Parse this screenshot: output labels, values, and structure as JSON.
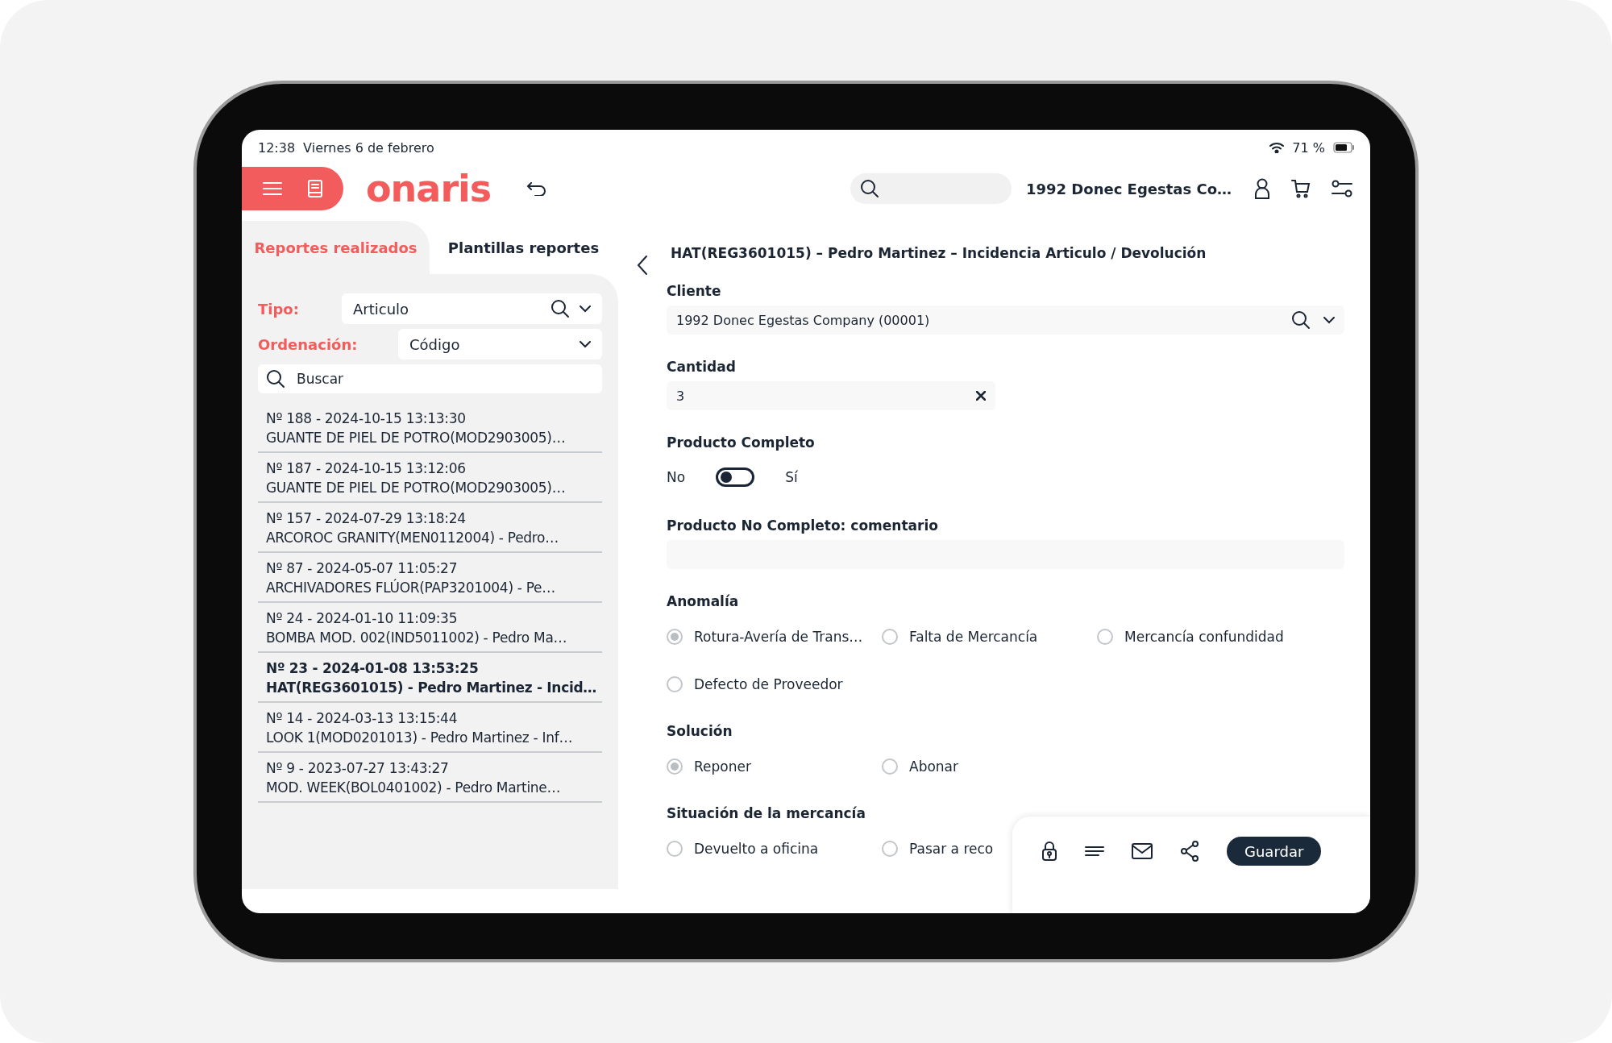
{
  "status_bar": {
    "time": "12:38",
    "date": "Viernes 6 de febrero",
    "battery": "71 %"
  },
  "header": {
    "logo": "onaris",
    "company": "1992 Donec Egestas Co…"
  },
  "tabs": [
    {
      "label": "Reportes realizados",
      "selected": true
    },
    {
      "label": "Plantillas reportes",
      "selected": false
    }
  ],
  "filters": [
    {
      "label": "Tipo:",
      "value": "Articulo",
      "searchable": true
    },
    {
      "label": "Ordenación:",
      "value": "Código",
      "searchable": false
    }
  ],
  "list_search": {
    "placeholder": "Buscar"
  },
  "reports": [
    {
      "line1": "Nº 188 - 2024-10-15 13:13:30",
      "line2": "GUANTE DE PIEL DE POTRO(MOD2903005)…",
      "selected": false
    },
    {
      "line1": "Nº 187 - 2024-10-15 13:12:06",
      "line2": "GUANTE DE PIEL DE POTRO(MOD2903005)…",
      "selected": false
    },
    {
      "line1": "Nº 157 - 2024-07-29 13:18:24",
      "line2": "ARCOROC GRANITY(MEN0112004) - Pedro…",
      "selected": false
    },
    {
      "line1": "Nº 87 - 2024-05-07 11:05:27",
      "line2": "ARCHIVADORES FLÚOR(PAP3201004) - Pe…",
      "selected": false
    },
    {
      "line1": "Nº 24 - 2024-01-10 11:09:35",
      "line2": "BOMBA MOD. 002(IND5011002) - Pedro Ma…",
      "selected": false
    },
    {
      "line1": "Nº 23 - 2024-01-08 13:53:25",
      "line2": "HAT(REG3601015) - Pedro Martinez - Incid…",
      "selected": true
    },
    {
      "line1": "Nº 14 - 2024-03-13 13:15:44",
      "line2": "LOOK 1(MOD0201013) - Pedro Martinez - Inf…",
      "selected": false
    },
    {
      "line1": "Nº 9 - 2023-07-27 13:43:27",
      "line2": "MOD. WEEK(BOL0401002) - Pedro Martine…",
      "selected": false
    }
  ],
  "form": {
    "title": "HAT(REG3601015) – Pedro Martinez – Incidencia Articulo / Devolución",
    "fields": [
      {
        "kind": "select",
        "label": "Cliente",
        "value": "1992 Donec Egestas Company (00001)"
      },
      {
        "kind": "number",
        "label": "Cantidad",
        "value": "3"
      },
      {
        "kind": "toggle",
        "label": "Producto Completo",
        "off_label": "No",
        "on_label": "Sí",
        "on": false
      },
      {
        "kind": "textarea",
        "label": "Producto No Completo: comentario"
      },
      {
        "kind": "radio",
        "label": "Anomalía",
        "options": [
          {
            "label": "Rotura-Avería de Trans…",
            "selected": true
          },
          {
            "label": "Falta de Mercancía",
            "selected": false
          },
          {
            "label": "Mercancía confundidad",
            "selected": false
          },
          {
            "label": "Defecto de Proveedor",
            "selected": false
          }
        ]
      },
      {
        "kind": "radio",
        "label": "Solución",
        "options": [
          {
            "label": "Reponer",
            "selected": true
          },
          {
            "label": "Abonar",
            "selected": false
          }
        ]
      },
      {
        "kind": "radio",
        "label": "Situación de la mercancía",
        "options": [
          {
            "label": "Devuelto a oficina",
            "selected": false
          },
          {
            "label": "Pasar a reco",
            "selected": false
          }
        ]
      }
    ]
  },
  "actions": {
    "button": "Guardar"
  }
}
